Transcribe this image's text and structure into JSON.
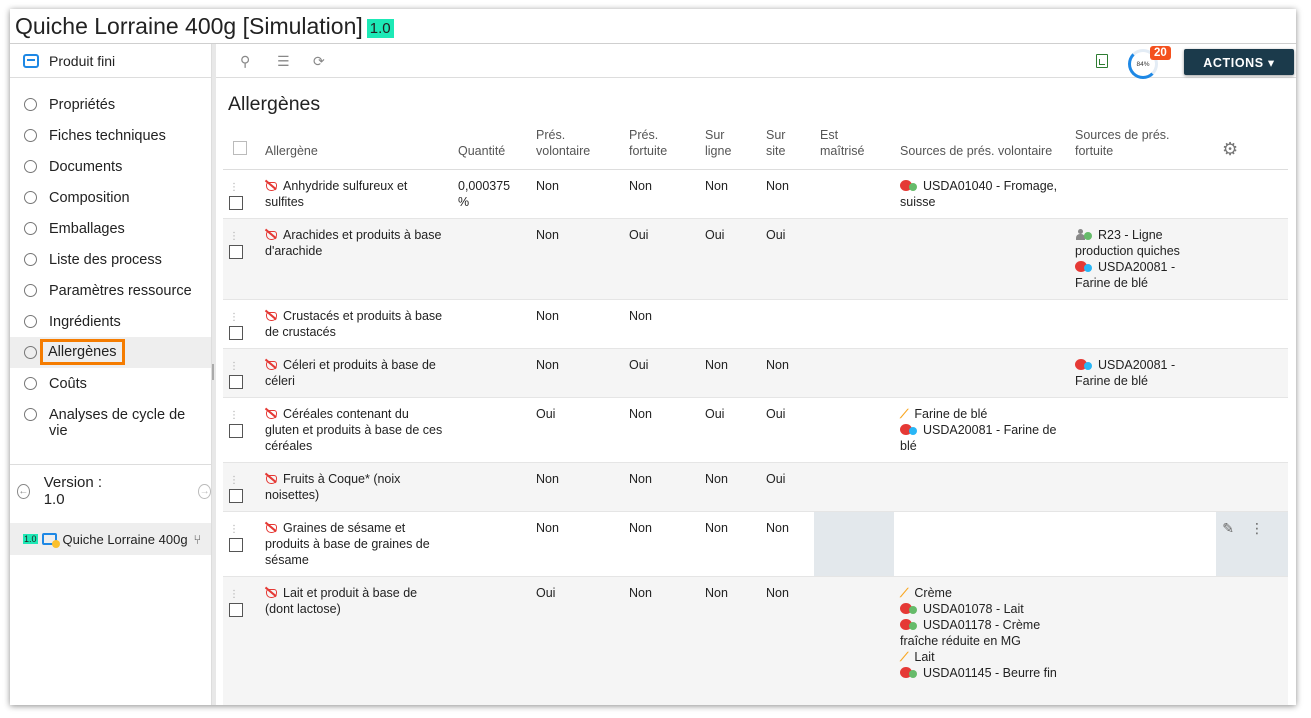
{
  "window": {
    "title": "Quiche Lorraine 400g [Simulation]",
    "version_badge": "1.0"
  },
  "sidebar": {
    "header": "Produit fini",
    "items": [
      {
        "label": "Propriétés",
        "active": false
      },
      {
        "label": "Fiches techniques",
        "active": false
      },
      {
        "label": "Documents",
        "active": false
      },
      {
        "label": "Composition",
        "active": false
      },
      {
        "label": "Emballages",
        "active": false
      },
      {
        "label": "Liste des process",
        "active": false
      },
      {
        "label": "Paramètres ressource",
        "active": false
      },
      {
        "label": "Ingrédients",
        "active": false
      },
      {
        "label": "Allergènes",
        "active": true
      },
      {
        "label": "Coûts",
        "active": false
      },
      {
        "label": "Analyses de cycle de vie",
        "active": false
      }
    ],
    "version_label": "Version : 1.0",
    "doc": {
      "badge": "1.0",
      "name": "Quiche Lorraine 400g"
    }
  },
  "toolbar": {
    "actions_label": "ACTIONS ▾",
    "progress_text": "84%",
    "counter": "20"
  },
  "page_title": "Allergènes",
  "table": {
    "headers": {
      "allergene": "Allergène",
      "quantite": "Quantité",
      "pres_vol_1": "Prés.",
      "pres_vol_2": "volontaire",
      "pres_fort_1": "Prés.",
      "pres_fort_2": "fortuite",
      "sur_ligne_1": "Sur",
      "sur_ligne_2": "ligne",
      "sur_site_1": "Sur",
      "sur_site_2": "site",
      "maitrise_1": "Est",
      "maitrise_2": "maîtrisé",
      "src_vol": "Sources de prés. volontaire",
      "src_fort_1": "Sources de prés.",
      "src_fort_2": "fortuite"
    },
    "rows": [
      {
        "name": "Anhydride sulfureux et sulfites",
        "qty": "0,000375 %",
        "vol": "Non",
        "fort": "Non",
        "ligne": "Non",
        "site": "Non",
        "src_vol": [
          {
            "icon": "tomato-green",
            "text": "USDA01040 - Fromage, suisse"
          }
        ],
        "src_fort": []
      },
      {
        "name": "Arachides et produits à base d'arachide",
        "qty": "",
        "vol": "Non",
        "fort": "Oui",
        "ligne": "Oui",
        "site": "Oui",
        "src_vol": [],
        "src_fort": [
          {
            "icon": "person-green",
            "text": "R23 - Ligne production quiches"
          },
          {
            "icon": "tomato-blue",
            "text": "USDA20081 - Farine de blé"
          }
        ]
      },
      {
        "name": "Crustacés et produits à base de crustacés",
        "qty": "",
        "vol": "Non",
        "fort": "Non",
        "ligne": "",
        "site": "",
        "src_vol": [],
        "src_fort": []
      },
      {
        "name": "Céleri et produits à base de céleri",
        "qty": "",
        "vol": "Non",
        "fort": "Oui",
        "ligne": "Non",
        "site": "Non",
        "src_vol": [],
        "src_fort": [
          {
            "icon": "tomato-blue",
            "text": "USDA20081 - Farine de blé"
          }
        ]
      },
      {
        "name": "Céréales contenant du gluten et produits à base de ces céréales",
        "qty": "",
        "vol": "Oui",
        "fort": "Non",
        "ligne": "Oui",
        "site": "Oui",
        "src_vol": [
          {
            "icon": "wheat",
            "text": "Farine de blé"
          },
          {
            "icon": "tomato-blue",
            "text": "USDA20081 - Farine de blé"
          }
        ],
        "src_fort": []
      },
      {
        "name": "Fruits à Coque* (noix noisettes)",
        "qty": "",
        "vol": "Non",
        "fort": "Non",
        "ligne": "Non",
        "site": "Oui",
        "src_vol": [],
        "src_fort": []
      },
      {
        "name": "Graines de sésame et produits à base de graines de sésame",
        "qty": "",
        "vol": "Non",
        "fort": "Non",
        "ligne": "Non",
        "site": "Non",
        "src_vol": [],
        "src_fort": []
      },
      {
        "name": "Lait et produit à base de (dont lactose)",
        "qty": "",
        "vol": "Oui",
        "fort": "Non",
        "ligne": "Non",
        "site": "Non",
        "src_vol": [
          {
            "icon": "wheat",
            "text": "Crème"
          },
          {
            "icon": "tomato-green",
            "text": "USDA01078 - Lait"
          },
          {
            "icon": "tomato-green",
            "text": "USDA01178 - Crème fraîche réduite en MG"
          },
          {
            "icon": "wheat",
            "text": "Lait"
          },
          {
            "icon": "tomato-green",
            "text": "USDA01145 - Beurre fin"
          }
        ],
        "src_fort": []
      }
    ]
  },
  "colors": {
    "accent_green": "#1de9b6",
    "actions_bg": "#1b3a4b",
    "oui_red": "#d32f2f",
    "highlight": "#f57c00"
  }
}
